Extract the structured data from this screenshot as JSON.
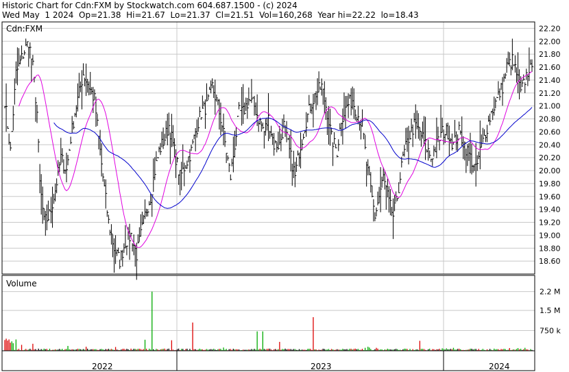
{
  "header": {
    "line1": "Historic Chart for Cdn:FXM by Stockwatch.com 604.687.1500 - (c) 2024",
    "line2": "Wed May  1 2024  Op=21.38  Hi=21.67  Lo=21.37  Cl=21.51  Vol=160,268  Year hi=22.22  lo=18.43"
  },
  "chart_data": [
    {
      "type": "line",
      "title": "",
      "symbol_label": "Cdn:FXM",
      "ylim": [
        18.4,
        22.3
      ],
      "y_ticks": [
        "22.20",
        "22.00",
        "21.80",
        "21.60",
        "21.40",
        "21.20",
        "21.00",
        "20.80",
        "20.60",
        "20.40",
        "20.20",
        "20.00",
        "19.80",
        "19.60",
        "19.40",
        "19.20",
        "19.00",
        "18.80",
        "18.60"
      ],
      "x_ticks": [
        "2022",
        "2023",
        "2024"
      ],
      "grid": true,
      "colors": {
        "bars": "#000000",
        "ma_short": "#e000e0",
        "ma_long": "#0000cc",
        "frame": "#000000"
      },
      "price_knots": [
        [
          0,
          21.1
        ],
        [
          4,
          20.3
        ],
        [
          8,
          21.5
        ],
        [
          13,
          21.8
        ],
        [
          17,
          22.0
        ],
        [
          20,
          21.6
        ],
        [
          23,
          20.9
        ],
        [
          25,
          19.8
        ],
        [
          28,
          19.2
        ],
        [
          32,
          19.3
        ],
        [
          36,
          19.7
        ],
        [
          40,
          20.2
        ],
        [
          44,
          20.0
        ],
        [
          47,
          20.5
        ],
        [
          50,
          20.9
        ],
        [
          53,
          21.2
        ],
        [
          56,
          21.5
        ],
        [
          60,
          21.3
        ],
        [
          64,
          21.1
        ],
        [
          67,
          20.5
        ],
        [
          70,
          19.9
        ],
        [
          74,
          19.2
        ],
        [
          78,
          18.8
        ],
        [
          82,
          18.6
        ],
        [
          86,
          18.9
        ],
        [
          90,
          19.0
        ],
        [
          94,
          18.7
        ],
        [
          97,
          19.0
        ],
        [
          101,
          19.4
        ],
        [
          104,
          19.6
        ],
        [
          107,
          20.0
        ],
        [
          110,
          20.3
        ],
        [
          114,
          20.5
        ],
        [
          117,
          20.7
        ],
        [
          121,
          20.3
        ],
        [
          125,
          19.9
        ],
        [
          129,
          20.1
        ],
        [
          133,
          20.3
        ],
        [
          136,
          20.6
        ],
        [
          140,
          20.9
        ],
        [
          144,
          21.0
        ],
        [
          148,
          21.3
        ],
        [
          152,
          21.0
        ],
        [
          155,
          20.7
        ],
        [
          158,
          20.3
        ],
        [
          161,
          19.9
        ],
        [
          164,
          20.4
        ],
        [
          167,
          20.9
        ],
        [
          170,
          20.9
        ],
        [
          174,
          21.1
        ],
        [
          178,
          21.0
        ],
        [
          181,
          20.8
        ],
        [
          185,
          20.6
        ],
        [
          188,
          20.8
        ],
        [
          192,
          20.4
        ],
        [
          196,
          20.4
        ],
        [
          199,
          20.7
        ],
        [
          203,
          20.3
        ],
        [
          207,
          19.9
        ],
        [
          210,
          20.3
        ],
        [
          214,
          20.7
        ],
        [
          218,
          21.0
        ],
        [
          222,
          21.2
        ],
        [
          226,
          21.3
        ],
        [
          230,
          20.9
        ],
        [
          233,
          20.5
        ],
        [
          237,
          20.3
        ],
        [
          240,
          20.8
        ],
        [
          244,
          21.0
        ],
        [
          248,
          21.1
        ],
        [
          251,
          20.9
        ],
        [
          255,
          20.7
        ],
        [
          258,
          20.1
        ],
        [
          261,
          19.7
        ],
        [
          264,
          19.3
        ],
        [
          267,
          19.6
        ],
        [
          270,
          19.9
        ],
        [
          274,
          19.5
        ],
        [
          277,
          19.3
        ],
        [
          280,
          19.6
        ],
        [
          284,
          20.2
        ],
        [
          288,
          20.5
        ],
        [
          292,
          20.7
        ],
        [
          296,
          20.6
        ],
        [
          300,
          20.4
        ],
        [
          304,
          20.2
        ],
        [
          308,
          20.4
        ],
        [
          312,
          20.6
        ],
        [
          316,
          20.6
        ],
        [
          320,
          20.4
        ],
        [
          324,
          20.6
        ],
        [
          328,
          20.4
        ],
        [
          332,
          20.2
        ],
        [
          336,
          20.0
        ],
        [
          339,
          20.3
        ],
        [
          343,
          20.6
        ],
        [
          347,
          20.9
        ],
        [
          351,
          21.1
        ],
        [
          355,
          21.3
        ],
        [
          358,
          21.6
        ],
        [
          362,
          21.7
        ],
        [
          365,
          21.5
        ],
        [
          368,
          21.2
        ],
        [
          371,
          21.4
        ],
        [
          374,
          21.6
        ],
        [
          376,
          21.51
        ]
      ],
      "bar_count": 377,
      "ma_short_period": 20,
      "ma_long_period": 50
    },
    {
      "type": "bar",
      "title": "Volume",
      "y_ticks": [
        "2.2 M",
        "1.5 M",
        "750 k"
      ],
      "ylim": [
        0,
        2700000
      ],
      "colors": {
        "up": "#00aa00",
        "down": "#dd0000",
        "base": "#000000"
      },
      "spikes": [
        [
          0,
          400000,
          "r"
        ],
        [
          1,
          450000,
          "r"
        ],
        [
          2,
          380000,
          "r"
        ],
        [
          3,
          420000,
          "r"
        ],
        [
          4,
          300000,
          "r"
        ],
        [
          5,
          350000,
          "g"
        ],
        [
          6,
          280000,
          "g"
        ],
        [
          8,
          420000,
          "g"
        ],
        [
          12,
          220000,
          "r"
        ],
        [
          20,
          260000,
          "r"
        ],
        [
          45,
          180000,
          "g"
        ],
        [
          58,
          150000,
          "r"
        ],
        [
          79,
          140000,
          "r"
        ],
        [
          100,
          410000,
          "g"
        ],
        [
          105,
          2200000,
          "g"
        ],
        [
          119,
          390000,
          "r"
        ],
        [
          134,
          1050000,
          "r"
        ],
        [
          156,
          120000,
          "g"
        ],
        [
          180,
          720000,
          "g"
        ],
        [
          184,
          720000,
          "g"
        ],
        [
          196,
          330000,
          "r"
        ],
        [
          220,
          1250000,
          "r"
        ],
        [
          257,
          110000,
          "g"
        ],
        [
          259,
          150000,
          "g"
        ],
        [
          260,
          120000,
          "g"
        ],
        [
          265,
          110000,
          "r"
        ],
        [
          296,
          370000,
          "r"
        ],
        [
          312,
          90000,
          "g"
        ],
        [
          315,
          90000,
          "g"
        ],
        [
          320,
          110000,
          "g"
        ],
        [
          360,
          100000,
          "r"
        ],
        [
          366,
          100000,
          "g"
        ],
        [
          371,
          110000,
          "g"
        ]
      ]
    }
  ]
}
